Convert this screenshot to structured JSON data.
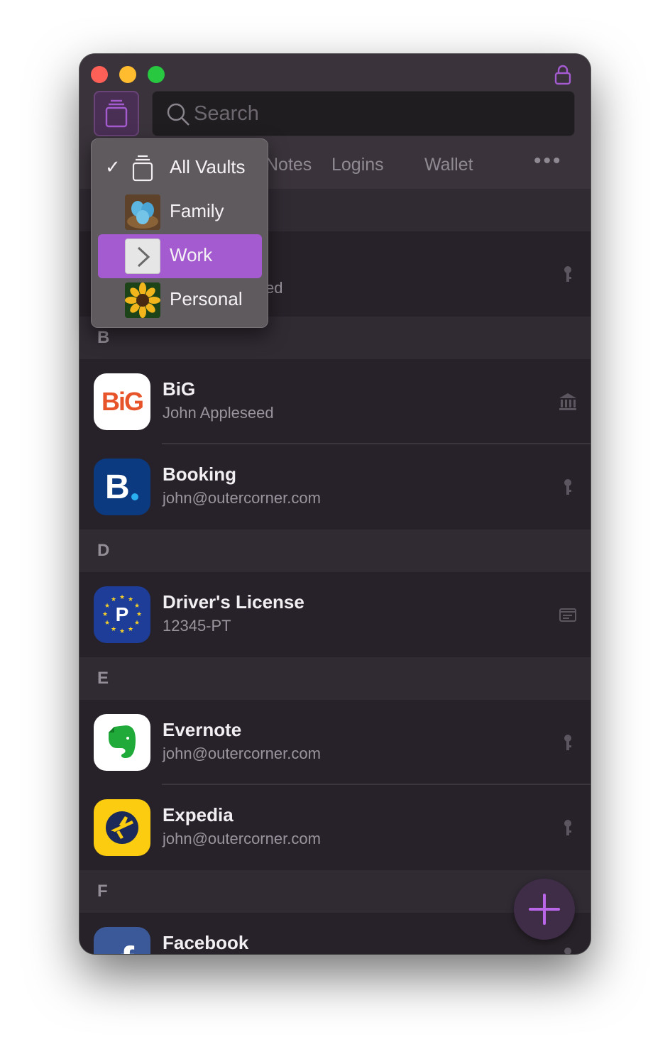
{
  "app": {
    "search_placeholder": "Search"
  },
  "tabs": [
    {
      "label": "Notes"
    },
    {
      "label": "Logins"
    },
    {
      "label": "Wallet"
    },
    {
      "label": "•••"
    }
  ],
  "vault_menu": {
    "items": [
      {
        "label": "All Vaults",
        "checked": true,
        "icon": "stack-icon"
      },
      {
        "label": "Family",
        "icon": "eggs-nest-icon"
      },
      {
        "label": "Work",
        "icon": "chevron-right-icon",
        "highlighted": true
      },
      {
        "label": "Personal",
        "icon": "sunflower-icon"
      }
    ]
  },
  "list": {
    "partial_row": {
      "subtitle_fragment": "ed"
    },
    "sections": [
      {
        "letter": "B"
      },
      {
        "letter": "D"
      },
      {
        "letter": "E"
      },
      {
        "letter": "F"
      }
    ],
    "items": [
      {
        "title": "BiG",
        "subtitle": "John Appleseed",
        "type_icon": "bank-icon",
        "icon_text": "BiG"
      },
      {
        "title": "Booking",
        "subtitle": "john@outercorner.com",
        "type_icon": "key-icon",
        "icon_text": "B."
      },
      {
        "title": "Driver's License",
        "subtitle": "12345-PT",
        "type_icon": "id-card-icon",
        "icon_text": "P"
      },
      {
        "title": "Evernote",
        "subtitle": "john@outercorner.com",
        "type_icon": "key-icon"
      },
      {
        "title": "Expedia",
        "subtitle": "john@outercorner.com",
        "type_icon": "key-icon"
      },
      {
        "title": "Facebook",
        "subtitle": "",
        "type_icon": "key-icon",
        "icon_text": "f"
      }
    ]
  },
  "colors": {
    "accent": "#a35bcf",
    "window_bg": "#282329",
    "section_bg": "#302a33"
  }
}
